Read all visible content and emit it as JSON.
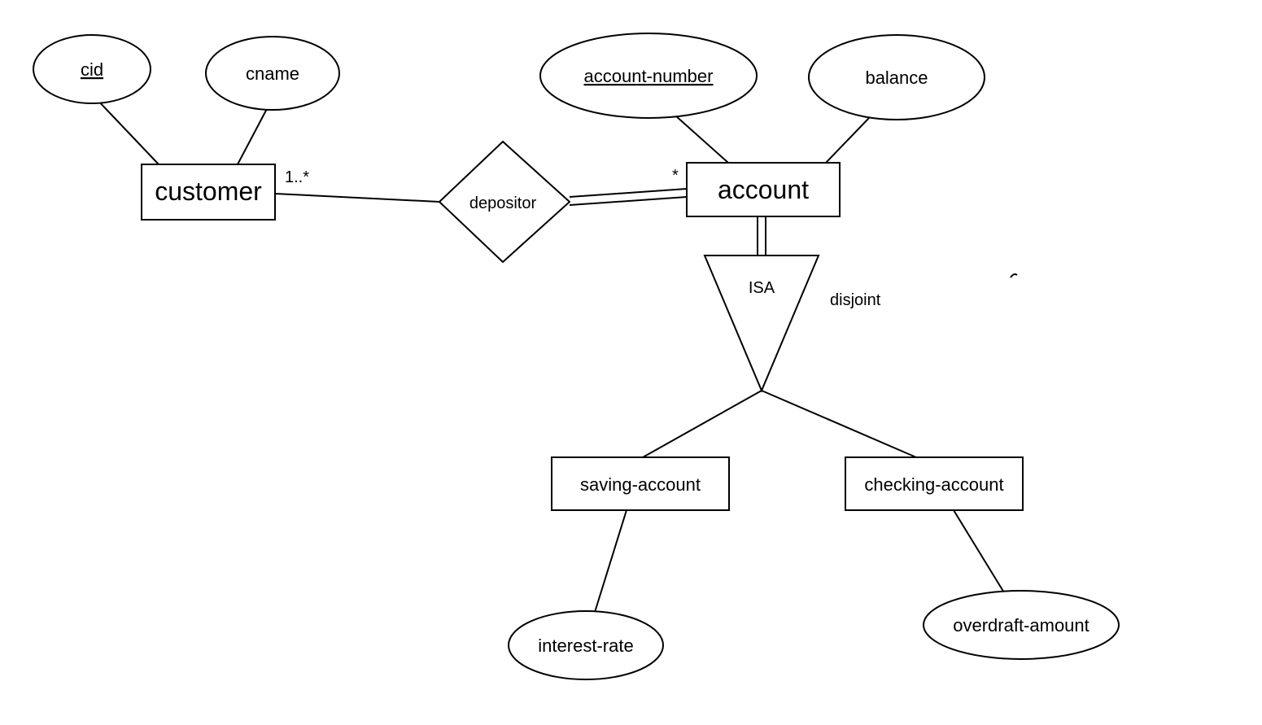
{
  "entities": {
    "customer": {
      "label": "customer"
    },
    "account": {
      "label": "account"
    },
    "saving_account": {
      "label": "saving-account"
    },
    "checking_account": {
      "label": "checking-account"
    }
  },
  "attributes": {
    "cid": {
      "label": "cid",
      "key": true
    },
    "cname": {
      "label": "cname",
      "key": false
    },
    "account_number": {
      "label": "account-number",
      "key": true
    },
    "balance": {
      "label": "balance",
      "key": false
    },
    "interest_rate": {
      "label": "interest-rate",
      "key": false
    },
    "overdraft_amount": {
      "label": "overdraft-amount",
      "key": false
    }
  },
  "relationships": {
    "depositor": {
      "label": "depositor"
    }
  },
  "isa": {
    "label": "ISA",
    "constraint": "disjoint"
  },
  "cardinalities": {
    "customer_depositor": "1..*",
    "account_depositor": "*"
  }
}
